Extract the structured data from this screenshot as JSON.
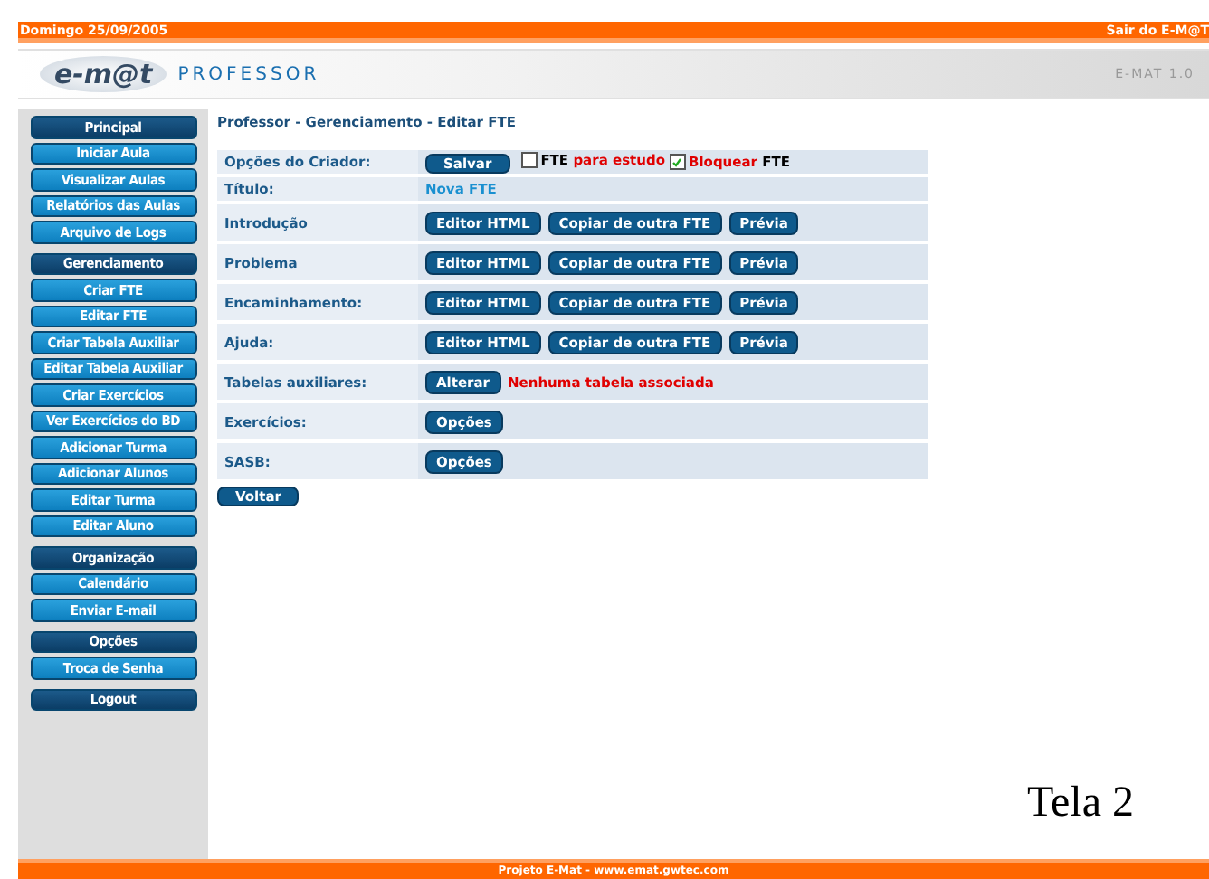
{
  "top_bar": {
    "date": "Domingo 25/09/2005",
    "exit_link": "Sair do E-M@T"
  },
  "header": {
    "logo": "e-m@t",
    "section": "PROFESSOR",
    "version": "E-MAT 1.0"
  },
  "sidebar": {
    "items": [
      {
        "label": "Principal",
        "kind": "header"
      },
      {
        "label": "Iniciar Aula",
        "kind": "item"
      },
      {
        "label": "Visualizar Aulas",
        "kind": "item"
      },
      {
        "label": "Relatórios das Aulas",
        "kind": "item"
      },
      {
        "label": "Arquivo de Logs",
        "kind": "item"
      },
      {
        "label": "Gerenciamento",
        "kind": "header"
      },
      {
        "label": "Criar FTE",
        "kind": "item"
      },
      {
        "label": "Editar FTE",
        "kind": "item"
      },
      {
        "label": "Criar Tabela Auxiliar",
        "kind": "item"
      },
      {
        "label": "Editar Tabela Auxiliar",
        "kind": "item"
      },
      {
        "label": "Criar Exercícios",
        "kind": "item"
      },
      {
        "label": "Ver Exercícios do BD",
        "kind": "item"
      },
      {
        "label": "Adicionar Turma",
        "kind": "item"
      },
      {
        "label": "Adicionar Alunos",
        "kind": "item"
      },
      {
        "label": "Editar Turma",
        "kind": "item"
      },
      {
        "label": "Editar Aluno",
        "kind": "item"
      },
      {
        "label": "Organização",
        "kind": "header"
      },
      {
        "label": "Calendário",
        "kind": "item"
      },
      {
        "label": "Enviar E-mail",
        "kind": "item"
      },
      {
        "label": "Opções",
        "kind": "header"
      },
      {
        "label": "Troca de Senha",
        "kind": "item"
      },
      {
        "label": "Logout",
        "kind": "header"
      }
    ]
  },
  "breadcrumb": "Professor - Gerenciamento - Editar FTE",
  "form": {
    "rows": [
      {
        "label": "Opções do Criador:",
        "kind": "options",
        "buttons": [
          "Salvar"
        ],
        "checkboxes": [
          {
            "checked": false,
            "parts": [
              {
                "text": "FTE",
                "alert": false
              },
              {
                "text": "para estudo",
                "alert": true
              }
            ]
          },
          {
            "checked": true,
            "parts": [
              {
                "text": "Bloquear",
                "alert": true
              },
              {
                "text": "FTE",
                "alert": false
              }
            ]
          }
        ]
      },
      {
        "label": "Título:",
        "kind": "value",
        "value": "Nova FTE"
      },
      {
        "label": "Introdução",
        "kind": "buttons",
        "buttons": [
          "Editor HTML",
          "Copiar de outra FTE",
          "Prévia"
        ]
      },
      {
        "label": "Problema",
        "kind": "buttons",
        "buttons": [
          "Editor HTML",
          "Copiar de outra FTE",
          "Prévia"
        ]
      },
      {
        "label": "Encaminhamento:",
        "kind": "buttons",
        "buttons": [
          "Editor HTML",
          "Copiar de outra FTE",
          "Prévia"
        ]
      },
      {
        "label": "Ajuda:",
        "kind": "buttons",
        "buttons": [
          "Editor HTML",
          "Copiar de outra FTE",
          "Prévia"
        ]
      },
      {
        "label": "Tabelas auxiliares:",
        "kind": "buttons",
        "buttons": [
          "Alterar"
        ],
        "note": "Nenhuma tabela associada"
      },
      {
        "label": "Exercícios:",
        "kind": "buttons",
        "buttons": [
          "Opções"
        ]
      },
      {
        "label": "SASB:",
        "kind": "buttons",
        "buttons": [
          "Opções"
        ]
      }
    ],
    "back_button": "Voltar"
  },
  "caption": "Tela 2",
  "footer": "Projeto E-Mat - www.emat.gwtec.com"
}
